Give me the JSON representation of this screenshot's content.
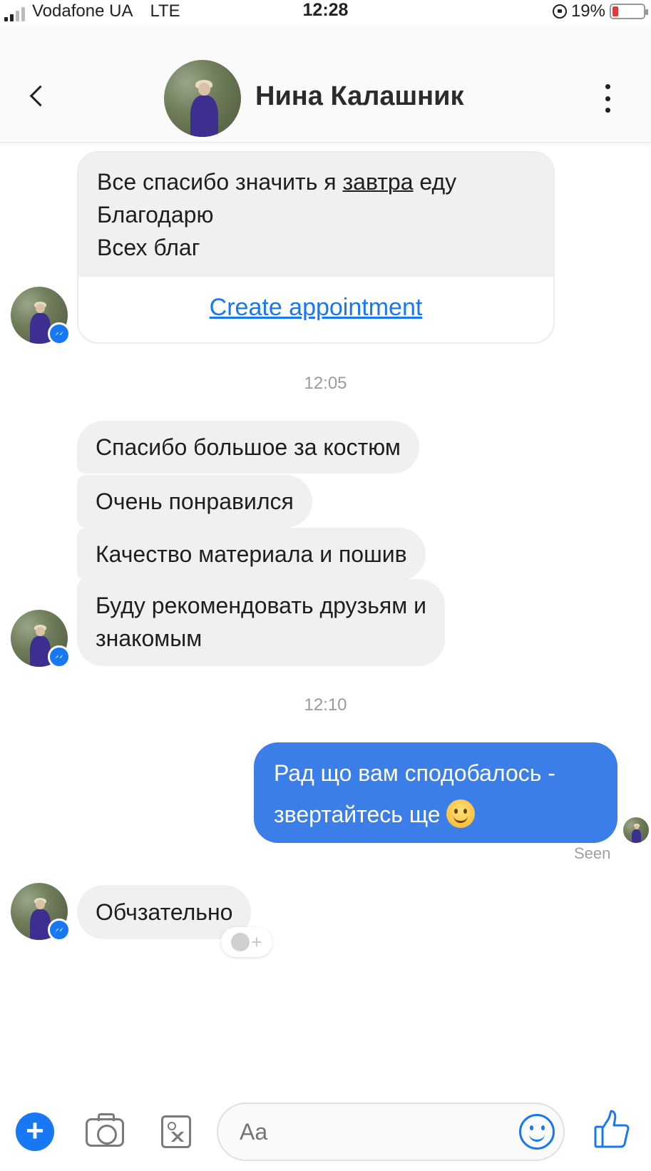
{
  "status_bar": {
    "carrier": "Vodafone UA",
    "network": "LTE",
    "time": "12:28",
    "battery": "19%",
    "battery_level": 0.19
  },
  "header": {
    "contact_name": "Нина Калашник",
    "back_icon": "chevron-left-icon",
    "more_icon": "vertical-dots-icon"
  },
  "messages": {
    "card": {
      "line1_before": "Все спасибо значить я ",
      "line1_underlined": "завтра",
      "line1_after": " еду",
      "line2": "Благодарю",
      "line3": "Всех благ",
      "action": "Create appointment"
    },
    "timestamp1": "12:05",
    "group1": [
      "Спасибо большое за костюм",
      "Очень понравился",
      "Качество материала и пошив",
      "Буду рекомендовать друзьям и",
      "знакомым"
    ],
    "timestamp2": "12:10",
    "outgoing": {
      "line1": "Рад що вам сподобалось -",
      "line2": "звертайтесь ще",
      "emoji": "smiling-face-emoji"
    },
    "seen": "Seen",
    "last_incoming": "Обчзательно",
    "react_plus": "+"
  },
  "composer": {
    "placeholder": "Aa",
    "plus": "+",
    "icons": [
      "plus-icon",
      "camera-icon",
      "image-icon",
      "emoji-icon",
      "thumbs-up-icon"
    ]
  },
  "colors": {
    "accent": "#1877f2",
    "outgoing_bubble": "#3b7ee8",
    "incoming_bubble": "#f0f0f0"
  }
}
